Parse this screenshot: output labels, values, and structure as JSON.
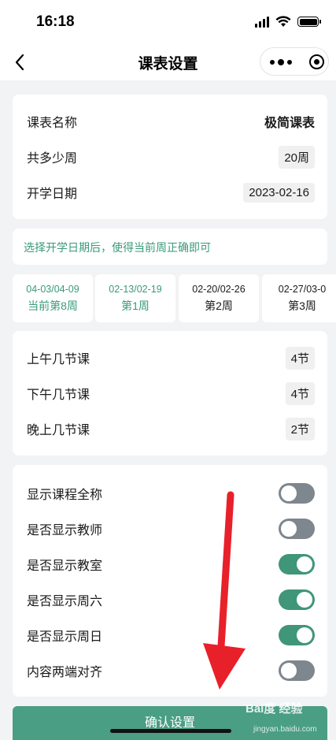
{
  "status_bar": {
    "time": "16:18"
  },
  "nav": {
    "title": "课表设置"
  },
  "basic": {
    "name_label": "课表名称",
    "name_value": "极简课表",
    "weeks_label": "共多少周",
    "weeks_value": "20周",
    "start_label": "开学日期",
    "start_value": "2023-02-16"
  },
  "hint": "选择开学日期后，使得当前周正确即可",
  "weeks": [
    {
      "range": "04-03/04-09",
      "name": "当前第8周"
    },
    {
      "range": "02-13/02-19",
      "name": "第1周"
    },
    {
      "range": "02-20/02-26",
      "name": "第2周"
    },
    {
      "range": "02-27/03-0",
      "name": "第3周"
    }
  ],
  "sessions": {
    "morning_label": "上午几节课",
    "morning_value": "4节",
    "afternoon_label": "下午几节课",
    "afternoon_value": "4节",
    "evening_label": "晚上几节课",
    "evening_value": "2节"
  },
  "toggles": [
    {
      "label": "显示课程全称",
      "on": false
    },
    {
      "label": "是否显示教师",
      "on": false
    },
    {
      "label": "是否显示教室",
      "on": true
    },
    {
      "label": "是否显示周六",
      "on": true
    },
    {
      "label": "是否显示周日",
      "on": true
    },
    {
      "label": "内容两端对齐",
      "on": false
    }
  ],
  "confirm_label": "确认设置",
  "watermark": {
    "main": "Bai度 经验",
    "sub": "jingyan.baidu.com"
  },
  "colors": {
    "accent": "#3f9679",
    "hint": "#3a9a7a",
    "button": "#4a9e83",
    "arrow": "#e8202a"
  }
}
